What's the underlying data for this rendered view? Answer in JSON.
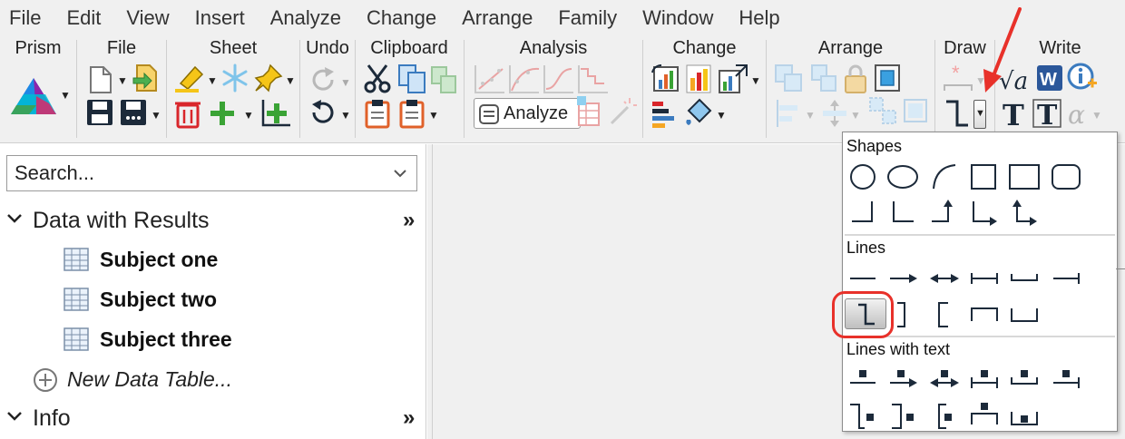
{
  "menu": [
    "File",
    "Edit",
    "View",
    "Insert",
    "Analyze",
    "Change",
    "Arrange",
    "Family",
    "Window",
    "Help"
  ],
  "ribbon": {
    "groups": {
      "prism": "Prism",
      "file": "File",
      "sheet": "Sheet",
      "undo": "Undo",
      "clipboard": "Clipboard",
      "analysis": "Analysis",
      "change": "Change",
      "arrange": "Arrange",
      "draw": "Draw",
      "write": "Write"
    },
    "analyze_label": "Analyze"
  },
  "navigator": {
    "search_placeholder": "Search...",
    "sections": {
      "data_with_results": "Data with Results",
      "info": "Info"
    },
    "items": [
      "Subject one",
      "Subject two",
      "Subject three"
    ],
    "new_table": "New Data Table..."
  },
  "dropdown": {
    "sections": [
      "Shapes",
      "Lines",
      "Lines with text"
    ]
  },
  "colors": {
    "accent": "#1f4e79",
    "highlight": "#e8312a",
    "delete_red": "#d9262b",
    "add_green": "#3aa335",
    "word_blue": "#2b579a"
  }
}
